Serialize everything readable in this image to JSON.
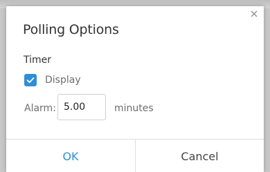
{
  "dialog": {
    "title": "Polling Options",
    "close_icon": "close-icon"
  },
  "timer": {
    "section_label": "Timer",
    "display": {
      "label": "Display",
      "checked": true,
      "icon": "checkmark-icon"
    },
    "alarm": {
      "label": "Alarm:",
      "value": "5.00",
      "unit": "minutes"
    }
  },
  "buttons": {
    "ok_label": "OK",
    "cancel_label": "Cancel"
  },
  "colors": {
    "accent": "#2e8fd6",
    "text_primary": "#333333",
    "text_secondary": "#6e6e6e"
  }
}
